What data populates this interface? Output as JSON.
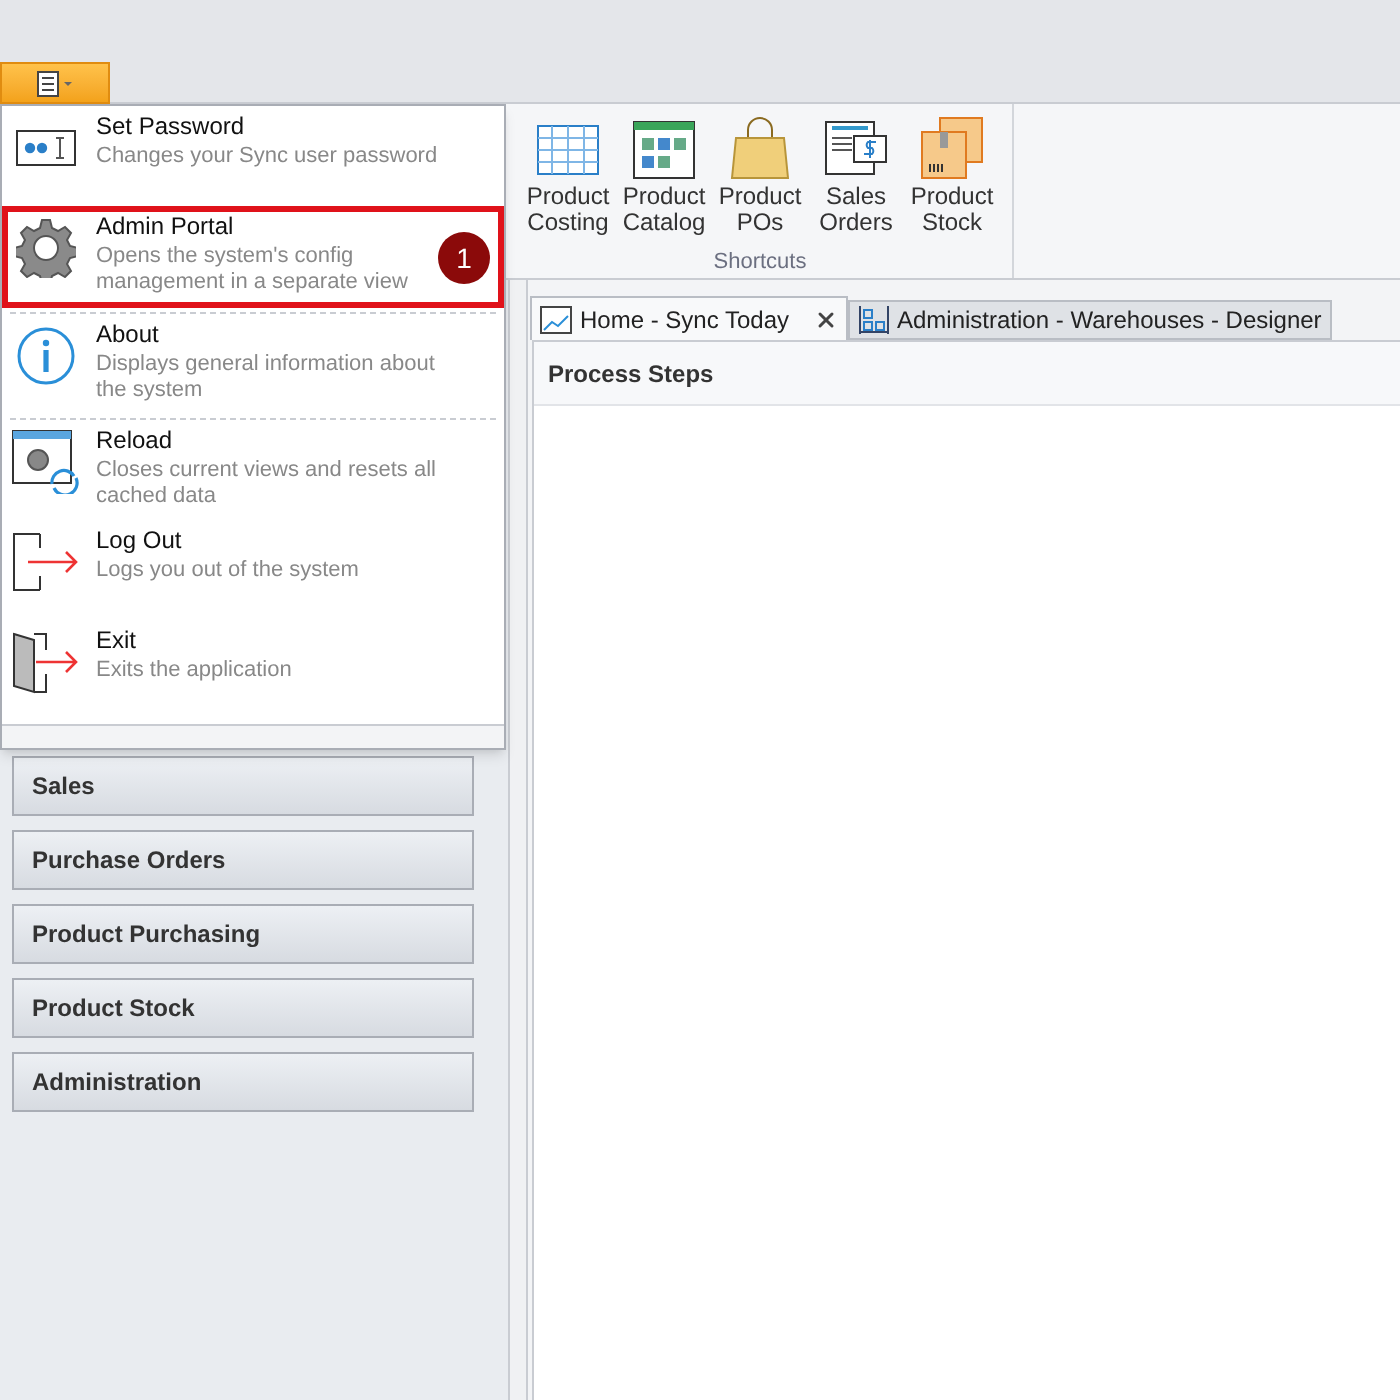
{
  "app_menu": {
    "items": [
      {
        "title": "Set Password",
        "description": "Changes your Sync user password",
        "divider_after": false
      },
      {
        "title": "Admin Portal",
        "description": "Opens the system's config management in a separate view",
        "callout": "1",
        "divider_after": true
      },
      {
        "title": "About",
        "description": "Displays general information about the system",
        "divider_after": true
      },
      {
        "title": "Reload",
        "description": "Closes current views and resets all cached data",
        "divider_after": false
      },
      {
        "title": "Log Out",
        "description": "Logs you out of the system",
        "divider_after": false
      },
      {
        "title": "Exit",
        "description": "Exits the application",
        "divider_after": false
      }
    ]
  },
  "ribbon": {
    "group": {
      "title": "Shortcuts",
      "buttons": [
        {
          "line1": "Product",
          "line2": "Costing"
        },
        {
          "line1": "Product",
          "line2": "Catalog"
        },
        {
          "line1": "Product",
          "line2": "POs"
        },
        {
          "line1": "Sales",
          "line2": "Orders"
        },
        {
          "line1": "Product",
          "line2": "Stock"
        }
      ]
    }
  },
  "sidebar": {
    "items": [
      "Sales",
      "Purchase Orders",
      "Product Purchasing",
      "Product Stock",
      "Administration"
    ]
  },
  "tabs": [
    {
      "label": "Home - Sync Today",
      "selected": true,
      "closable": true
    },
    {
      "label": "Administration - Warehouses - Designer",
      "selected": false,
      "closable": false
    }
  ],
  "panel": {
    "title": "Process Steps"
  }
}
